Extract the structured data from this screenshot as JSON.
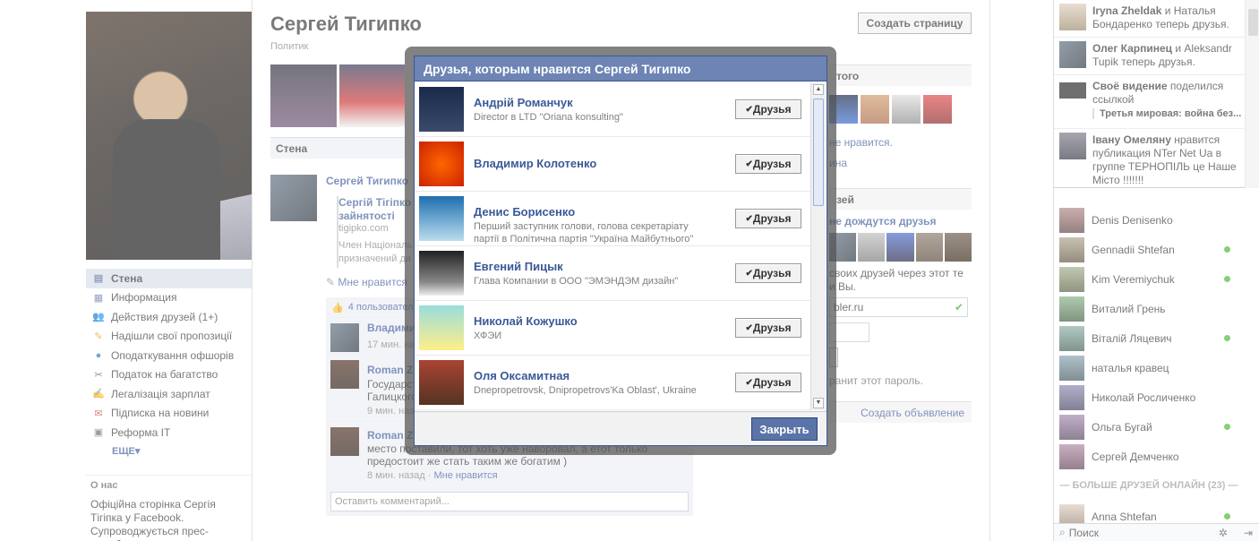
{
  "profile": {
    "name": "Сергей Тигипко",
    "category": "Политик",
    "create_page_label": "Создать страницу"
  },
  "left_nav": {
    "items": [
      {
        "label": "Стена",
        "icon": "wall-icon"
      },
      {
        "label": "Информация",
        "icon": "info-icon"
      },
      {
        "label": "Действия друзей (1+)",
        "icon": "friends-activity-icon"
      },
      {
        "label": "Надішли свої пропозиції",
        "icon": "pencil-icon"
      },
      {
        "label": "Оподаткування офшорів",
        "icon": "globe-icon"
      },
      {
        "label": "Податок на багатство",
        "icon": "scissors-icon"
      },
      {
        "label": "Легалізація зарплат",
        "icon": "legal-icon"
      },
      {
        "label": "Підписка на новини",
        "icon": "mail-icon"
      },
      {
        "label": "Реформа IT",
        "icon": "computer-icon"
      }
    ],
    "more_label": "ЕЩЕ▾"
  },
  "about": {
    "heading": "О нас",
    "text": "Офіційна сторінка Сергія Тігіпка у Facebook. Супроводжується прес-службою..."
  },
  "wall": {
    "tab_label": "Стена",
    "post_author": "Сергей Тигипко",
    "share_title": "Сергій Тігіпко зайнятості",
    "share_domain": "tigipko.com",
    "share_desc": "Член Національ призначений ди",
    "like_link": "Мне нравится",
    "likes_count": "4 пользователя",
    "comments": [
      {
        "name": "Владими",
        "text": "",
        "time": "17 мин. наз"
      },
      {
        "name": "Roman Z",
        "text": "Государст Галицкого",
        "time": "9 мин. наз"
      },
      {
        "name": "Roman Z",
        "text": "место поставили, тот хоть уже наворовал, а етот только предостоит же стать таким же богатим )",
        "time": "8 мин. назад",
        "like": "Мне нравится"
      }
    ],
    "comment_placeholder": "Оставить комментарий..."
  },
  "right_col": {
    "head1": "того",
    "liked": "не нравится.",
    "liked2": "ина",
    "head2": "зей",
    "waiting": "не дождутся друзья",
    "invite_text": "своих друзей через этот те и Вы.",
    "email_value": "bler.ru",
    "save_note": "ранит этот пароль.",
    "ad_label": "Создать объявление"
  },
  "dialog": {
    "title": "Друзья, которым нравится Сергей Тигипко",
    "friend_button": "Друзья",
    "friends": [
      {
        "name": "Андрій Романчук",
        "sub": "Director в LTD \"Oriana konsulting\""
      },
      {
        "name": "Владимир Колотенко",
        "sub": ""
      },
      {
        "name": "Денис Борисенко",
        "sub": "Перший заступник голови, голова секретаріату партії в Політична партія \"Україна Майбутнього\""
      },
      {
        "name": "Евгений Пицык",
        "sub": "Глава Компании в ООО \"ЭМЭНДЭМ дизайн\""
      },
      {
        "name": "Николай Кожушко",
        "sub": "ХФЭИ"
      },
      {
        "name": "Оля Оксамитная",
        "sub": "Dnepropetrovsk, Dnipropetrovs'Ka Oblast', Ukraine"
      }
    ],
    "close_label": "Закрыть"
  },
  "ticker": [
    {
      "bold": "Iryna Zheldak",
      "rest": " и Наталья Бондаренко теперь друзья."
    },
    {
      "bold": "Олег Карпинец",
      "rest": " и Aleksandr Tupik теперь друзья."
    },
    {
      "bold": "Своё видение",
      "rest": " поделился ссылкой",
      "quote": "Третья мировая: война без..."
    },
    {
      "bold": "Івану Омеляну",
      "rest": " нравится публикация NTer Net Ua в группе ТЕРНОПІЛЬ це Наше Місто !!!!!!!"
    }
  ],
  "chat": {
    "friends": [
      {
        "name": "Denis Denisenko",
        "online": false
      },
      {
        "name": "Gennadii Shtefan",
        "online": true
      },
      {
        "name": "Kim Veremiychuk",
        "online": true
      },
      {
        "name": "Виталий Грень",
        "online": false
      },
      {
        "name": "Віталій Ляцевич",
        "online": true
      },
      {
        "name": "наталья кравец",
        "online": false
      },
      {
        "name": "Николай Росличенко",
        "online": false
      },
      {
        "name": "Ольга Бугай",
        "online": true
      },
      {
        "name": "Сергей Демченко",
        "online": false
      }
    ],
    "more_online": "— БОЛЬШЕ ДРУЗЕЙ ОНЛАЙН (23) —",
    "extra_friend": "Anna Shtefan",
    "search_label": "Поиск"
  }
}
